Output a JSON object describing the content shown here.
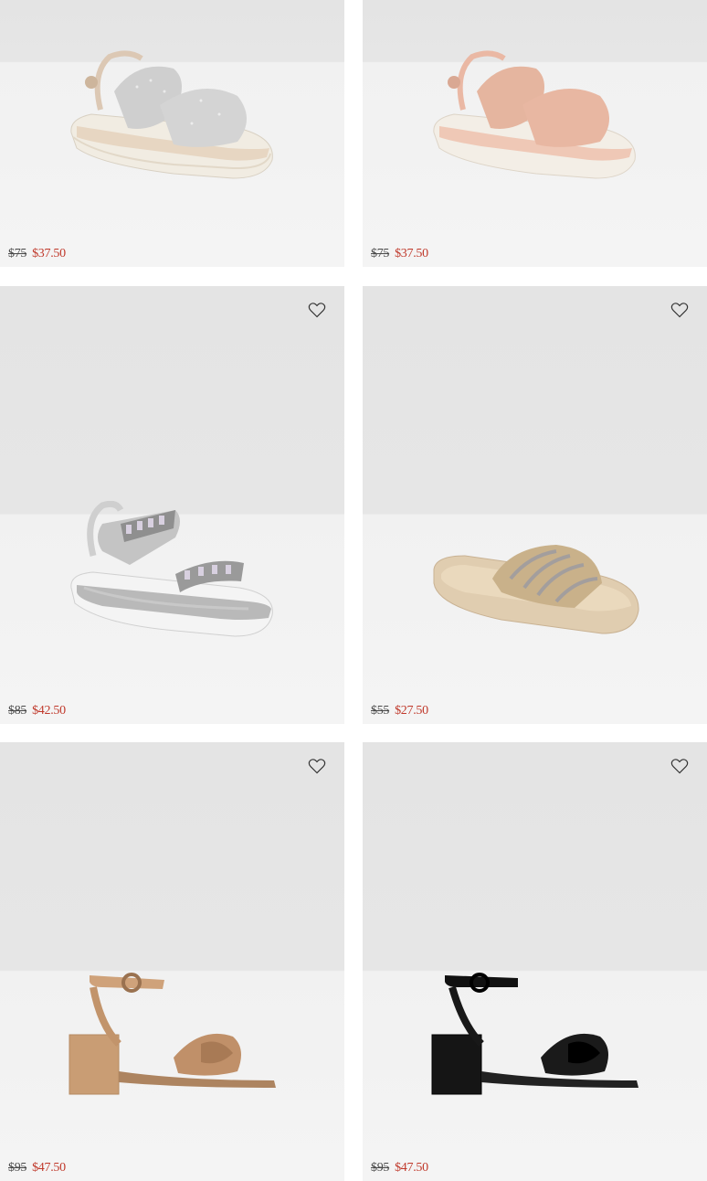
{
  "products": [
    {
      "original_price": "$75",
      "sale_price": "$37.50",
      "name": "silver rhinestone two-strap platform sandal",
      "wishlist_icon": "heart-icon",
      "has_wishlist": false
    },
    {
      "original_price": "$75",
      "sale_price": "$37.50",
      "name": "blush rhinestone two-strap platform sandal",
      "wishlist_icon": "heart-icon",
      "has_wishlist": false
    },
    {
      "original_price": "$85",
      "sale_price": "$42.50",
      "name": "silver jewelled sport sandal",
      "wishlist_icon": "heart-icon",
      "has_wishlist": true
    },
    {
      "original_price": "$55",
      "sale_price": "$27.50",
      "name": "gold jewelled pool slide",
      "wishlist_icon": "heart-icon",
      "has_wishlist": true
    },
    {
      "original_price": "$95",
      "sale_price": "$47.50",
      "name": "tan bow block-heel sandal",
      "wishlist_icon": "heart-icon",
      "has_wishlist": true
    },
    {
      "original_price": "$95",
      "sale_price": "$47.50",
      "name": "black bow block-heel sandal",
      "wishlist_icon": "heart-icon",
      "has_wishlist": true
    }
  ],
  "colors": {
    "sale_price": "#c0392b",
    "original_price": "#4a4a4a",
    "card_bg_top": "#e6e6e6",
    "card_bg_bottom": "#f4f4f4"
  }
}
